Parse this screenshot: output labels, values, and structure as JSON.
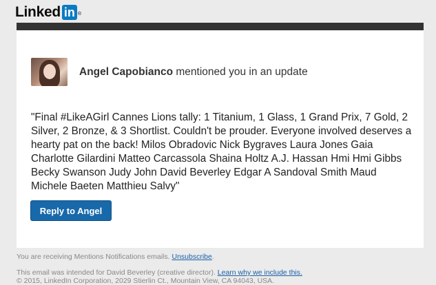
{
  "brand": {
    "logo_text": "Linked",
    "logo_in": "in",
    "logo_mark": "®"
  },
  "notification": {
    "actor_name": "Angel Capobianco",
    "action_text": " mentioned you in an update",
    "avatar_icon": "profile-photo",
    "message": "\"Final #LikeAGirl Cannes Lions tally: 1 Titanium, 1 Glass, 1 Grand Prix, 7 Gold, 2 Silver, 2 Bronze, & 3 Shortlist. Couldn't be prouder. Everyone involved deserves a hearty pat on the back! Milos Obradovic Nick Bygraves Laura Jones Gaia Charlotte Gilardini Matteo Carcassola Shaina Holtz A.J. Hassan Hmi Hmi Gibbs Becky Swanson Judy John David Beverley Edgar A Sandoval Smith Maud Michele Baeten Matthieu Salvy\"",
    "reply_label": "Reply to Angel"
  },
  "footer": {
    "mentions_text": "You are receiving Mentions Notifications emails. ",
    "unsubscribe_label": "Unsubscribe",
    "mentions_end": ".",
    "intended_text": "This email was intended for David Beverley (creative director). ",
    "learn_label": "Learn why we include this.",
    "copyright": "© 2015, LinkedIn Corporation, 2029 Stierlin Ct., Mountain View, CA 94043, USA."
  },
  "colors": {
    "brand_blue": "#0a7bc1",
    "button_blue": "#1869aa",
    "header_bar": "#333333",
    "link_blue": "#1a5fa8"
  }
}
